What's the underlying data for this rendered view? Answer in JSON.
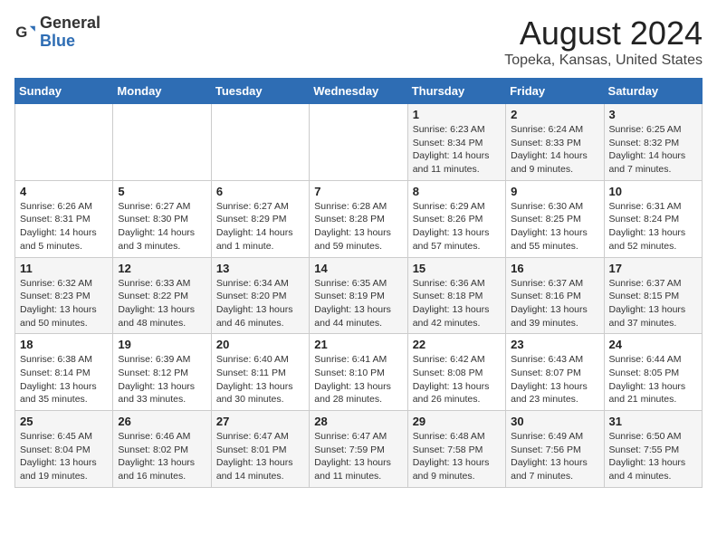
{
  "header": {
    "logo_general": "General",
    "logo_blue": "Blue",
    "month_title": "August 2024",
    "location": "Topeka, Kansas, United States"
  },
  "days_of_week": [
    "Sunday",
    "Monday",
    "Tuesday",
    "Wednesday",
    "Thursday",
    "Friday",
    "Saturday"
  ],
  "weeks": [
    [
      {
        "day": "",
        "info": ""
      },
      {
        "day": "",
        "info": ""
      },
      {
        "day": "",
        "info": ""
      },
      {
        "day": "",
        "info": ""
      },
      {
        "day": "1",
        "info": "Sunrise: 6:23 AM\nSunset: 8:34 PM\nDaylight: 14 hours and 11 minutes."
      },
      {
        "day": "2",
        "info": "Sunrise: 6:24 AM\nSunset: 8:33 PM\nDaylight: 14 hours and 9 minutes."
      },
      {
        "day": "3",
        "info": "Sunrise: 6:25 AM\nSunset: 8:32 PM\nDaylight: 14 hours and 7 minutes."
      }
    ],
    [
      {
        "day": "4",
        "info": "Sunrise: 6:26 AM\nSunset: 8:31 PM\nDaylight: 14 hours and 5 minutes."
      },
      {
        "day": "5",
        "info": "Sunrise: 6:27 AM\nSunset: 8:30 PM\nDaylight: 14 hours and 3 minutes."
      },
      {
        "day": "6",
        "info": "Sunrise: 6:27 AM\nSunset: 8:29 PM\nDaylight: 14 hours and 1 minute."
      },
      {
        "day": "7",
        "info": "Sunrise: 6:28 AM\nSunset: 8:28 PM\nDaylight: 13 hours and 59 minutes."
      },
      {
        "day": "8",
        "info": "Sunrise: 6:29 AM\nSunset: 8:26 PM\nDaylight: 13 hours and 57 minutes."
      },
      {
        "day": "9",
        "info": "Sunrise: 6:30 AM\nSunset: 8:25 PM\nDaylight: 13 hours and 55 minutes."
      },
      {
        "day": "10",
        "info": "Sunrise: 6:31 AM\nSunset: 8:24 PM\nDaylight: 13 hours and 52 minutes."
      }
    ],
    [
      {
        "day": "11",
        "info": "Sunrise: 6:32 AM\nSunset: 8:23 PM\nDaylight: 13 hours and 50 minutes."
      },
      {
        "day": "12",
        "info": "Sunrise: 6:33 AM\nSunset: 8:22 PM\nDaylight: 13 hours and 48 minutes."
      },
      {
        "day": "13",
        "info": "Sunrise: 6:34 AM\nSunset: 8:20 PM\nDaylight: 13 hours and 46 minutes."
      },
      {
        "day": "14",
        "info": "Sunrise: 6:35 AM\nSunset: 8:19 PM\nDaylight: 13 hours and 44 minutes."
      },
      {
        "day": "15",
        "info": "Sunrise: 6:36 AM\nSunset: 8:18 PM\nDaylight: 13 hours and 42 minutes."
      },
      {
        "day": "16",
        "info": "Sunrise: 6:37 AM\nSunset: 8:16 PM\nDaylight: 13 hours and 39 minutes."
      },
      {
        "day": "17",
        "info": "Sunrise: 6:37 AM\nSunset: 8:15 PM\nDaylight: 13 hours and 37 minutes."
      }
    ],
    [
      {
        "day": "18",
        "info": "Sunrise: 6:38 AM\nSunset: 8:14 PM\nDaylight: 13 hours and 35 minutes."
      },
      {
        "day": "19",
        "info": "Sunrise: 6:39 AM\nSunset: 8:12 PM\nDaylight: 13 hours and 33 minutes."
      },
      {
        "day": "20",
        "info": "Sunrise: 6:40 AM\nSunset: 8:11 PM\nDaylight: 13 hours and 30 minutes."
      },
      {
        "day": "21",
        "info": "Sunrise: 6:41 AM\nSunset: 8:10 PM\nDaylight: 13 hours and 28 minutes."
      },
      {
        "day": "22",
        "info": "Sunrise: 6:42 AM\nSunset: 8:08 PM\nDaylight: 13 hours and 26 minutes."
      },
      {
        "day": "23",
        "info": "Sunrise: 6:43 AM\nSunset: 8:07 PM\nDaylight: 13 hours and 23 minutes."
      },
      {
        "day": "24",
        "info": "Sunrise: 6:44 AM\nSunset: 8:05 PM\nDaylight: 13 hours and 21 minutes."
      }
    ],
    [
      {
        "day": "25",
        "info": "Sunrise: 6:45 AM\nSunset: 8:04 PM\nDaylight: 13 hours and 19 minutes."
      },
      {
        "day": "26",
        "info": "Sunrise: 6:46 AM\nSunset: 8:02 PM\nDaylight: 13 hours and 16 minutes."
      },
      {
        "day": "27",
        "info": "Sunrise: 6:47 AM\nSunset: 8:01 PM\nDaylight: 13 hours and 14 minutes."
      },
      {
        "day": "28",
        "info": "Sunrise: 6:47 AM\nSunset: 7:59 PM\nDaylight: 13 hours and 11 minutes."
      },
      {
        "day": "29",
        "info": "Sunrise: 6:48 AM\nSunset: 7:58 PM\nDaylight: 13 hours and 9 minutes."
      },
      {
        "day": "30",
        "info": "Sunrise: 6:49 AM\nSunset: 7:56 PM\nDaylight: 13 hours and 7 minutes."
      },
      {
        "day": "31",
        "info": "Sunrise: 6:50 AM\nSunset: 7:55 PM\nDaylight: 13 hours and 4 minutes."
      }
    ]
  ]
}
